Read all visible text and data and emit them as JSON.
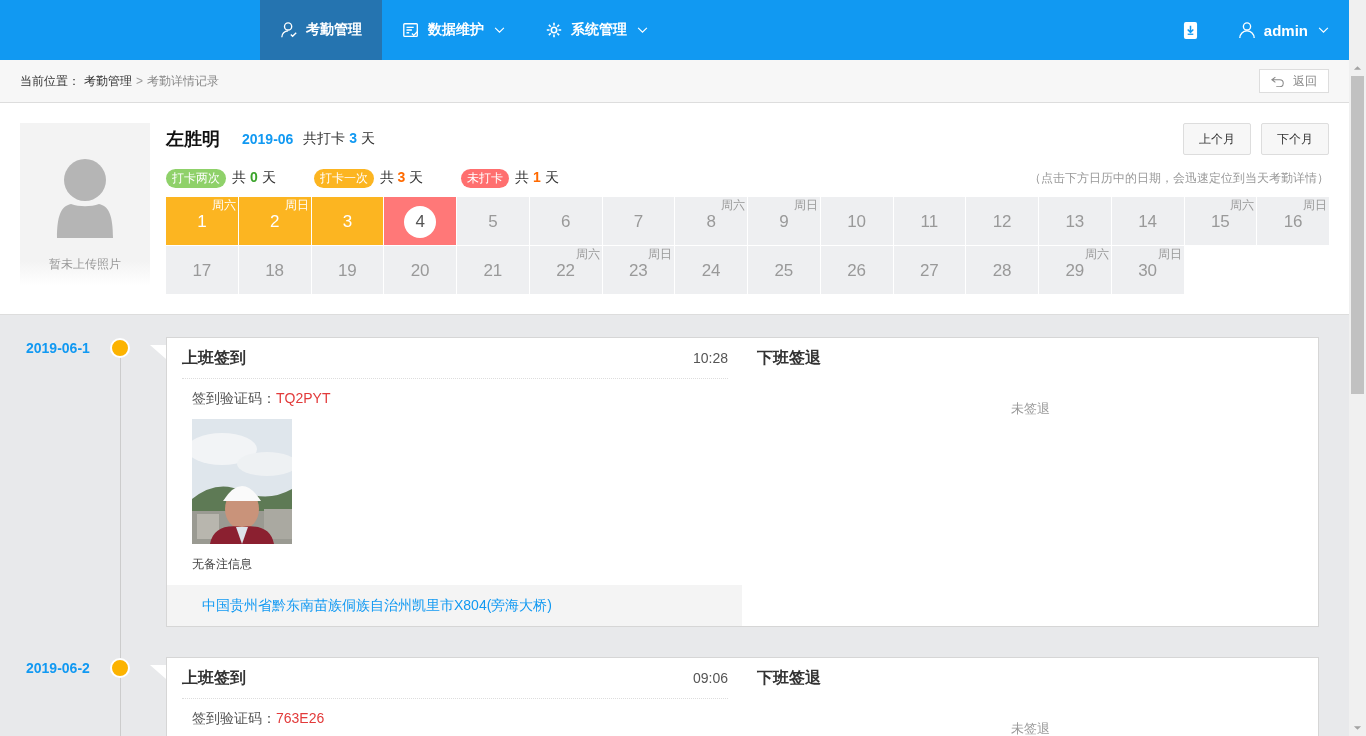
{
  "nav": {
    "items": [
      {
        "label": "考勤管理",
        "dropdown": false,
        "selected": true
      },
      {
        "label": "数据维护",
        "dropdown": true,
        "selected": false
      },
      {
        "label": "系统管理",
        "dropdown": true,
        "selected": false
      }
    ],
    "user": "admin"
  },
  "breadcrumb": {
    "prefix": "当前位置：",
    "parent": "考勤管理",
    "separator": ">",
    "current": "考勤详情记录",
    "back": "返回"
  },
  "profile": {
    "photo_hint": "暂未上传照片",
    "name": "左胜明",
    "month": "2019-06",
    "total_prefix": "共打卡",
    "total": "3",
    "total_unit": "天",
    "prev": "上个月",
    "next": "下个月",
    "hint": "（点击下方日历中的日期，会迅速定位到当天考勤详情）",
    "legend": [
      {
        "kind": "twice",
        "label": "打卡两次",
        "color": "#8fd16a",
        "prefix": "共",
        "count": "0",
        "unit": "天"
      },
      {
        "kind": "once",
        "label": "打卡一次",
        "color": "#fcb521",
        "prefix": "共",
        "count": "3",
        "unit": "天"
      },
      {
        "kind": "missed",
        "label": "未打卡",
        "color": "#ff6f6f",
        "prefix": "共",
        "count": "1",
        "unit": "天"
      }
    ]
  },
  "calendar": [
    {
      "day": "1",
      "weekday": "周六",
      "kind": "once",
      "today": false
    },
    {
      "day": "2",
      "weekday": "周日",
      "kind": "once",
      "today": false
    },
    {
      "day": "3",
      "kind": "once",
      "today": false
    },
    {
      "day": "4",
      "kind": "missed",
      "today": true
    },
    {
      "day": "5",
      "kind": "none",
      "today": false
    },
    {
      "day": "6",
      "kind": "none",
      "today": false
    },
    {
      "day": "7",
      "kind": "none",
      "today": false
    },
    {
      "day": "8",
      "weekday": "周六",
      "kind": "none",
      "today": false
    },
    {
      "day": "9",
      "weekday": "周日",
      "kind": "none",
      "today": false
    },
    {
      "day": "10",
      "kind": "none",
      "today": false
    },
    {
      "day": "11",
      "kind": "none",
      "today": false
    },
    {
      "day": "12",
      "kind": "none",
      "today": false
    },
    {
      "day": "13",
      "kind": "none",
      "today": false
    },
    {
      "day": "14",
      "kind": "none",
      "today": false
    },
    {
      "day": "15",
      "weekday": "周六",
      "kind": "none",
      "today": false
    },
    {
      "day": "16",
      "weekday": "周日",
      "kind": "none",
      "today": false
    },
    {
      "day": "17",
      "kind": "none",
      "today": false
    },
    {
      "day": "18",
      "kind": "none",
      "today": false
    },
    {
      "day": "19",
      "kind": "none",
      "today": false
    },
    {
      "day": "20",
      "kind": "none",
      "today": false
    },
    {
      "day": "21",
      "kind": "none",
      "today": false
    },
    {
      "day": "22",
      "weekday": "周六",
      "kind": "none",
      "today": false
    },
    {
      "day": "23",
      "weekday": "周日",
      "kind": "none",
      "today": false
    },
    {
      "day": "24",
      "kind": "none",
      "today": false
    },
    {
      "day": "25",
      "kind": "none",
      "today": false
    },
    {
      "day": "26",
      "kind": "none",
      "today": false
    },
    {
      "day": "27",
      "kind": "none",
      "today": false
    },
    {
      "day": "28",
      "kind": "none",
      "today": false
    },
    {
      "day": "29",
      "weekday": "周六",
      "kind": "none",
      "today": false
    },
    {
      "day": "30",
      "weekday": "周日",
      "kind": "none",
      "today": false
    }
  ],
  "records": [
    {
      "date": "2019-06-1",
      "checkin": {
        "title": "上班签到",
        "time": "10:28",
        "code_label": "签到验证码：",
        "code": "TQ2PYT",
        "note": "无备注信息",
        "address": "中国贵州省黔东南苗族侗族自治州凯里市X804(旁海大桥)"
      },
      "checkout": {
        "title": "下班签退",
        "status": "未签退"
      }
    },
    {
      "date": "2019-06-2",
      "checkin": {
        "title": "上班签到",
        "time": "09:06",
        "code_label": "签到验证码：",
        "code": "763E26"
      },
      "checkout": {
        "title": "下班签退",
        "status": "未签退"
      }
    }
  ]
}
